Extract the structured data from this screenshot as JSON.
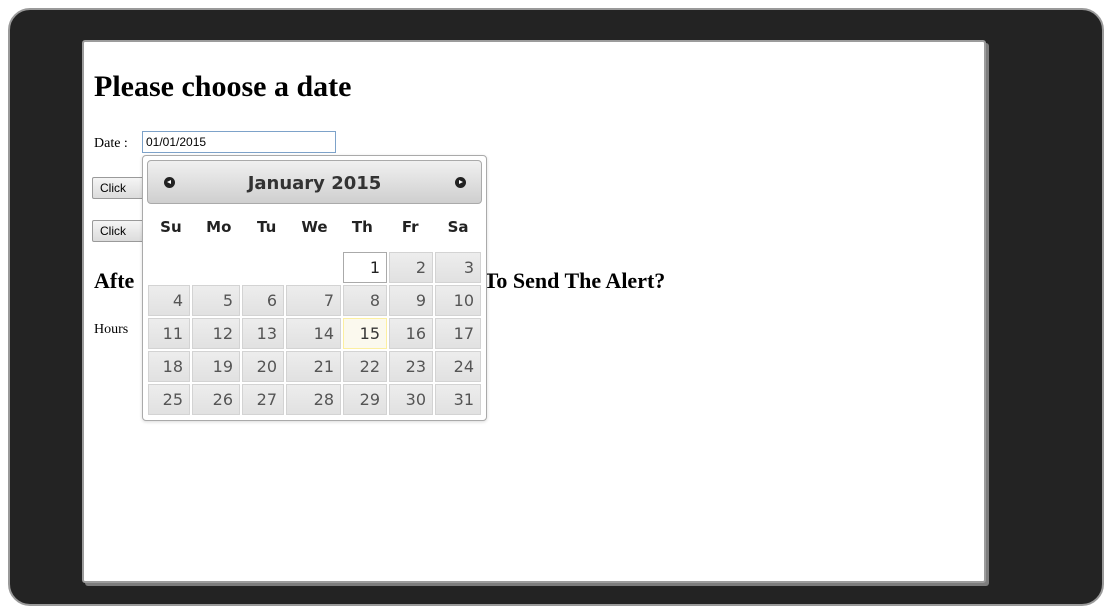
{
  "page": {
    "title": "Please choose a date",
    "date_label": "Date :",
    "date_value": "01/01/2015",
    "button1_label": "Click",
    "button2_label": "Click",
    "question_left": "Afte",
    "question_right": "t To Send The Alert?",
    "hours_label": "Hours"
  },
  "datepicker": {
    "month": "January",
    "year": "2015",
    "prev_icon": "circle-triangle-left-icon",
    "next_icon": "circle-triangle-right-icon",
    "weekdays": [
      "Su",
      "Mo",
      "Tu",
      "We",
      "Th",
      "Fr",
      "Sa"
    ],
    "leading_blanks": 4,
    "days": [
      "1",
      "2",
      "3",
      "4",
      "5",
      "6",
      "7",
      "8",
      "9",
      "10",
      "11",
      "12",
      "13",
      "14",
      "15",
      "16",
      "17",
      "18",
      "19",
      "20",
      "21",
      "22",
      "23",
      "24",
      "25",
      "26",
      "27",
      "28",
      "29",
      "30",
      "31"
    ],
    "selected_day": "1",
    "highlighted_day": "15"
  },
  "colors": {
    "frame": "#232323",
    "today_highlight": "#fbf9ee",
    "input_border": "#7da2c9"
  }
}
